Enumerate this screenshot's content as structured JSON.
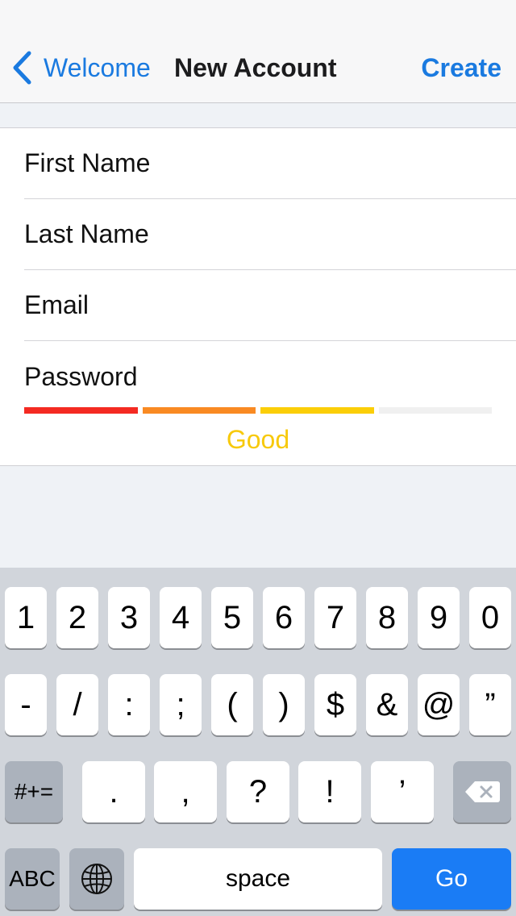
{
  "navbar": {
    "back_label": "Welcome",
    "title": "New Account",
    "create_label": "Create",
    "accent": "#1a7ae0"
  },
  "form": {
    "first_name": {
      "placeholder": "First Name",
      "value": ""
    },
    "last_name": {
      "placeholder": "Last Name",
      "value": ""
    },
    "email": {
      "placeholder": "Email",
      "value": ""
    },
    "password": {
      "placeholder": "Password",
      "value": ""
    },
    "strength": {
      "label": "Good",
      "level": 3,
      "max": 4,
      "colors": [
        "#f42a22",
        "#f98a23",
        "#fbce08",
        "#f0f0f0"
      ],
      "label_color": "#f7c90b"
    }
  },
  "keyboard": {
    "row1": [
      "1",
      "2",
      "3",
      "4",
      "5",
      "6",
      "7",
      "8",
      "9",
      "0"
    ],
    "row2": [
      "-",
      "/",
      ":",
      ";",
      "(",
      ")",
      "$",
      "&",
      "@",
      "”"
    ],
    "row3": [
      ".",
      ",",
      "?",
      "!",
      "’"
    ],
    "switch_symbols": "#+=",
    "delete_icon": "backspace-icon",
    "switch_letters": "ABC",
    "globe_icon": "globe-icon",
    "space": "space",
    "go": "Go",
    "go_color": "#1a7cf5"
  }
}
